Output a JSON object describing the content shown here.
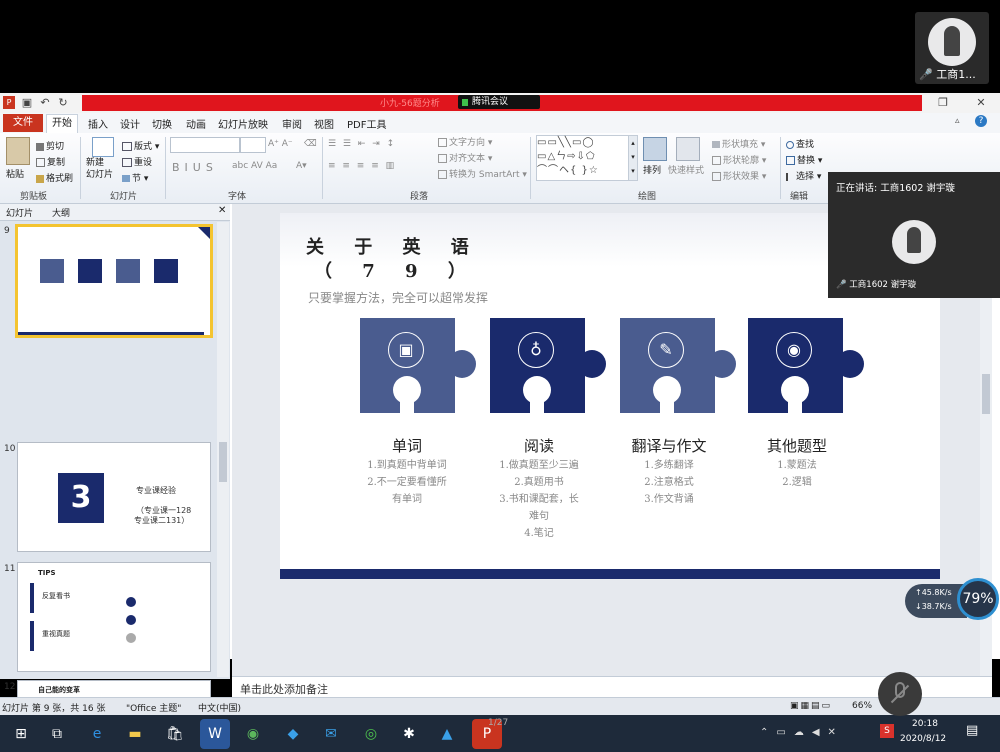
{
  "meeting": {
    "participant_name": "工商1...",
    "title_pill": "腾讯会议",
    "speaking_header": "正在讲话: 工商1602 谢宇璇",
    "speaker_name": "工商1602 谢宇璇",
    "page_indicator": "1/27",
    "title_tail": "小九-56题分析"
  },
  "ribbon": {
    "tabs": [
      "开始",
      "插入",
      "设计",
      "切换",
      "动画",
      "幻灯片放映",
      "审阅",
      "视图",
      "PDF工具"
    ],
    "file_tab": "文件",
    "clipboard": {
      "paste": "粘贴",
      "cut": "剪切",
      "copy": "复制",
      "format_painter": "格式刷",
      "group": "剪贴板"
    },
    "slides": {
      "new_slide": "新建\n幻灯片",
      "layout": "版式",
      "reset": "重设",
      "section": "节",
      "group": "幻灯片"
    },
    "font": {
      "group": "字体"
    },
    "paragraph": {
      "text_direction": "文字方向",
      "align_text": "对齐文本",
      "smartart": "转换为 SmartArt",
      "group": "段落"
    },
    "drawing": {
      "arrange": "排列",
      "quick_styles": "快速样式",
      "shape_fill": "形状填充",
      "shape_outline": "形状轮廓",
      "shape_effects": "形状效果",
      "group": "绘图"
    },
    "editing": {
      "find": "查找",
      "replace": "替换",
      "select": "选择",
      "group": "编辑"
    }
  },
  "pane": {
    "tab_slides": "幻灯片",
    "tab_outline": "大纲",
    "thumbs": [
      {
        "num": "9"
      },
      {
        "num": "10",
        "big": "3",
        "line1": "专业课经验",
        "line2": "（专业课一128",
        "line3": "专业课二131）"
      },
      {
        "num": "11",
        "title": "TIPS",
        "a": "反复看书",
        "b": "重视真题"
      },
      {
        "num": "12",
        "title": "自己能的变革"
      }
    ]
  },
  "slide": {
    "title_line1": "关 于 英 语",
    "title_line2": "（ 7 9 ）",
    "subtitle": "只要掌握方法，完全可以超常发挥",
    "categories": [
      {
        "name": "单词",
        "items": [
          "1.到真题中背单词",
          "2.不一定要看懂所",
          "有单词"
        ]
      },
      {
        "name": "阅读",
        "items": [
          "1.做真题至少三遍",
          "2.真题用书",
          "3.书和课配套，长",
          "难句",
          "4.笔记"
        ]
      },
      {
        "name": "翻译与作文",
        "items": [
          "1.多练翻译",
          "2.注意格式",
          "3.作文背诵"
        ]
      },
      {
        "name": "其他题型",
        "items": [
          "1.蒙题法",
          "2.逻辑"
        ]
      }
    ],
    "colors": [
      "#4a5c8f",
      "#1a2a6c",
      "#4a5c8f",
      "#1a2a6c"
    ]
  },
  "notes_placeholder": "单击此处添加备注",
  "status": {
    "slide_info": "幻灯片 第 9 张，共 16 张",
    "theme": "\"Office 主题\"",
    "lang": "中文(中国)",
    "zoom": "66%"
  },
  "taskbar": {
    "time": "20:18",
    "date": "2020/8/12"
  },
  "network": {
    "up": "45.8K/s",
    "down": "38.7K/s",
    "percent": "79%"
  }
}
